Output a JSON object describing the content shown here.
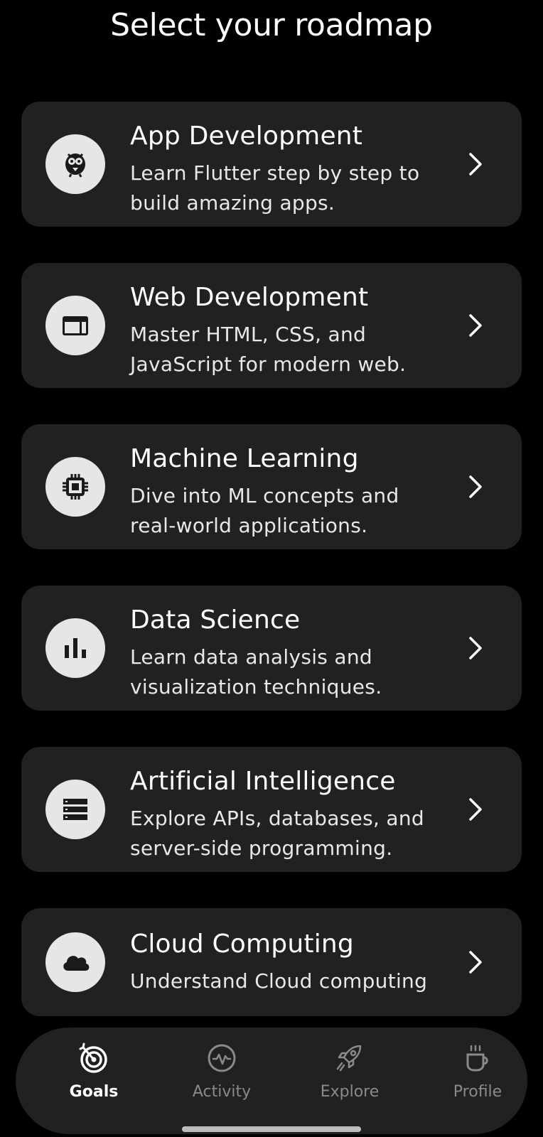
{
  "header": {
    "title": "Select your roadmap"
  },
  "roadmaps": [
    {
      "title": "App Development",
      "description": "Learn Flutter step by step to build amazing apps.",
      "icon": "flutter-bird-icon"
    },
    {
      "title": "Web Development",
      "description": "Master HTML, CSS, and JavaScript for modern web.",
      "icon": "browser-window-icon"
    },
    {
      "title": "Machine Learning",
      "description": "Dive into ML concepts and real-world applications.",
      "icon": "chip-icon"
    },
    {
      "title": "Data Science",
      "description": "Learn data analysis and visualization techniques.",
      "icon": "bar-chart-icon"
    },
    {
      "title": "Artificial Intelligence",
      "description": "Explore APIs, databases, and server-side programming.",
      "icon": "server-icon"
    },
    {
      "title": "Cloud Computing",
      "description": "Understand Cloud computing",
      "icon": "cloud-icon"
    }
  ],
  "bottom_nav": {
    "items": [
      {
        "label": "Goals",
        "icon": "target-icon",
        "active": true
      },
      {
        "label": "Activity",
        "icon": "pulse-icon",
        "active": false
      },
      {
        "label": "Explore",
        "icon": "rocket-icon",
        "active": false
      },
      {
        "label": "Profile",
        "icon": "coffee-cup-icon",
        "active": false
      }
    ]
  },
  "colors": {
    "background": "#000000",
    "card": "#212121",
    "icon_circle": "#e6e6e6",
    "nav_inactive": "#8a8a8a"
  }
}
